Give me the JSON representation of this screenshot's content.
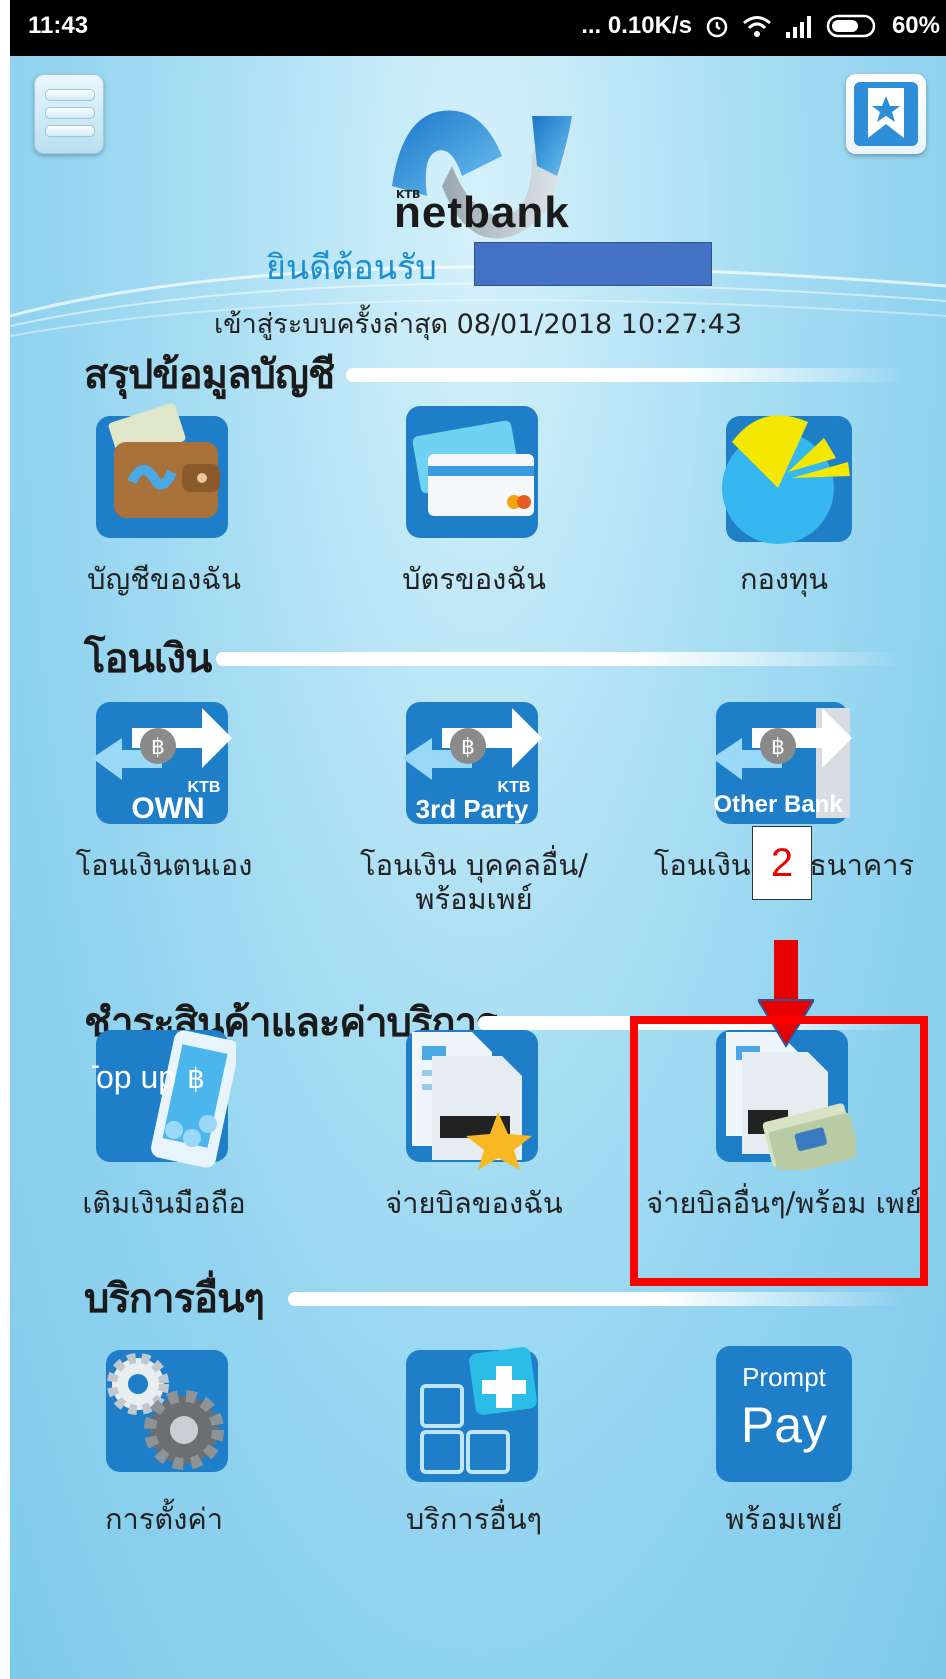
{
  "status_bar": {
    "time": "11:43",
    "net_speed": "... 0.10K/s",
    "battery": "60%"
  },
  "app": {
    "brand_small": "KTB",
    "brand": "netbank",
    "welcome": "ยินดีต้อนรับ",
    "last_login": "เข้าสู่ระบบครั้งล่าสุด 08/01/2018 10:27:43"
  },
  "sections": {
    "summary": {
      "title": "สรุปข้อมูลบัญชี",
      "items": [
        {
          "label": "บัญชีของฉัน",
          "icon": "wallet-icon"
        },
        {
          "label": "บัตรของฉัน",
          "icon": "credit-card-icon"
        },
        {
          "label": "กองทุน",
          "icon": "pie-chart-icon"
        }
      ]
    },
    "transfer": {
      "title": "โอนเงิน",
      "items": [
        {
          "label": "โอนเงินตนเอง",
          "icon": "ktb-own-icon",
          "badge_top": "KTB",
          "badge": "OWN"
        },
        {
          "label": "โอนเงิน บุคคลอื่น/ พร้อมเพย์",
          "icon": "ktb-3rd-party-icon",
          "badge_top": "KTB",
          "badge": "3rd Party"
        },
        {
          "label": "โอนเงิน ต่างธนาคาร",
          "icon": "other-bank-icon",
          "badge": "Other Bank"
        }
      ]
    },
    "payment": {
      "title": "ชำระสินค้าและค่าบริการ",
      "items": [
        {
          "label": "เติมเงินมือถือ",
          "icon": "top-up-icon",
          "badge": "Top up"
        },
        {
          "label": "จ่ายบิลของฉัน",
          "icon": "my-bill-icon"
        },
        {
          "label": "จ่ายบิลอื่นๆ/พร้อม เพย์",
          "icon": "other-bill-icon"
        }
      ]
    },
    "other": {
      "title": "บริการอื่นๆ",
      "items": [
        {
          "label": "การตั้งค่า",
          "icon": "gears-icon"
        },
        {
          "label": "บริการอื่นๆ",
          "icon": "more-services-icon"
        },
        {
          "label": "พร้อมเพย์",
          "icon": "promptpay-icon",
          "badge_top": "Prompt",
          "badge": "Pay"
        }
      ]
    }
  },
  "annotation": {
    "step": "2",
    "color": "#ff0000"
  },
  "colors": {
    "accent": "#1a8fd1",
    "tile_blue": "#1e7fc8",
    "highlight": "#ff0000"
  }
}
